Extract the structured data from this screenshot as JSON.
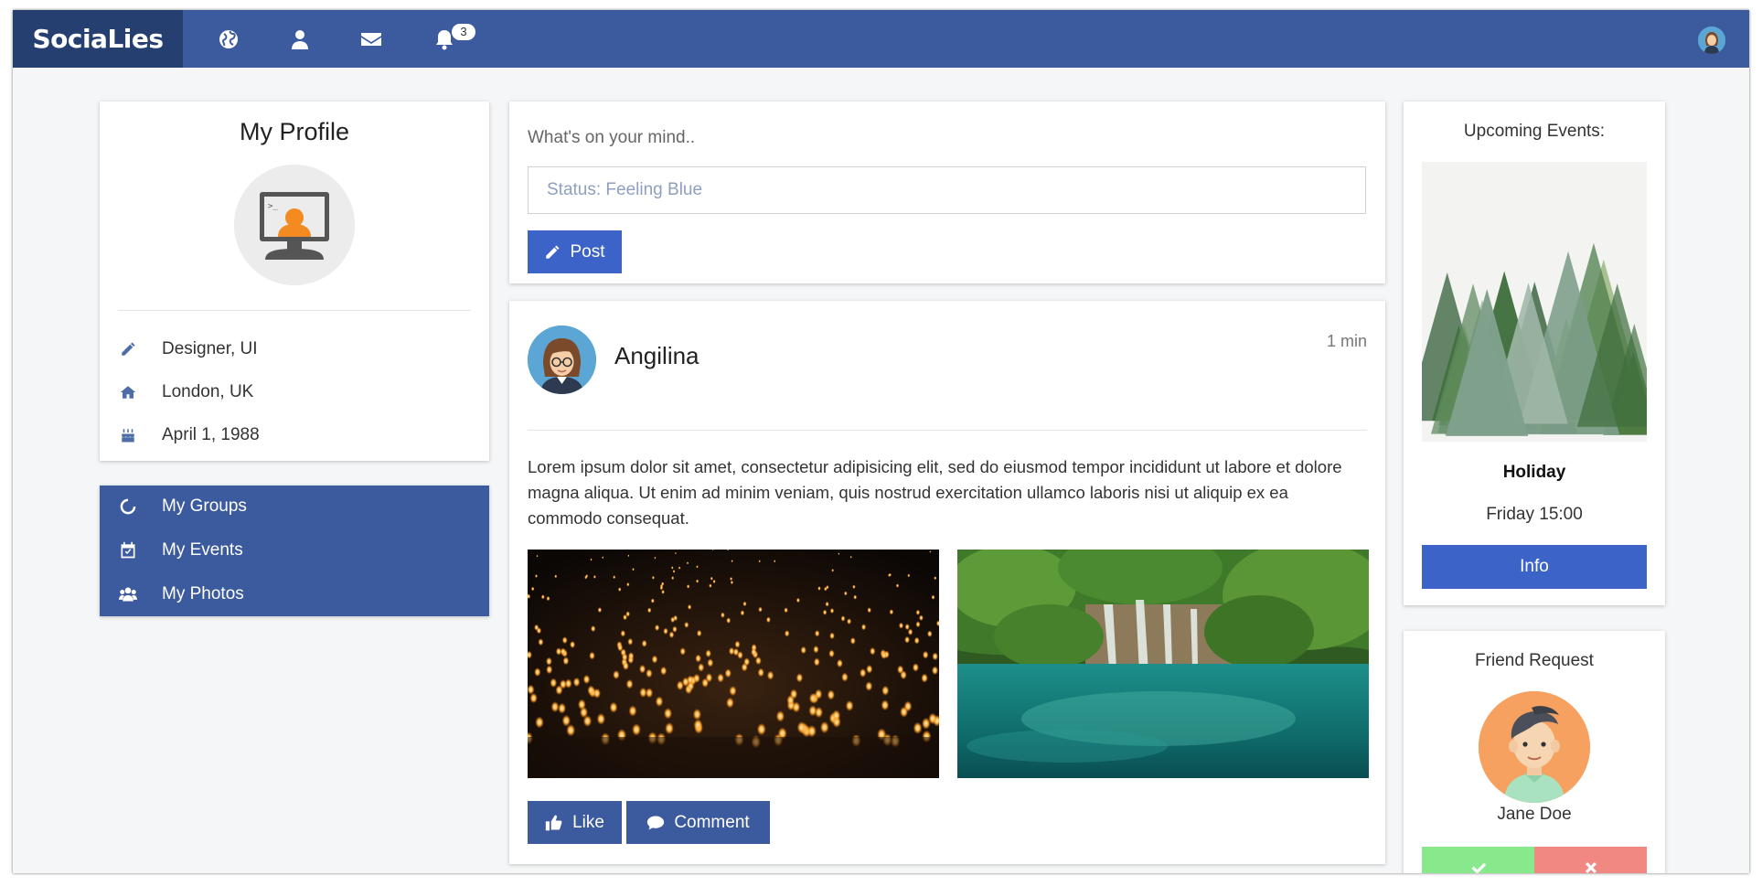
{
  "navbar": {
    "brand": "SociaLies",
    "notification_count": "3",
    "icons": [
      "globe-icon",
      "user-icon",
      "envelope-icon",
      "bell-icon"
    ],
    "color": "#3c5a9e",
    "brand_color": "#253f70"
  },
  "profile": {
    "title": "My Profile",
    "details": [
      {
        "icon": "pencil-icon",
        "text": "Designer, UI"
      },
      {
        "icon": "home-icon",
        "text": "London, UK"
      },
      {
        "icon": "birthday-cake-icon",
        "text": "April 1, 1988"
      }
    ]
  },
  "menu": {
    "items": [
      {
        "icon": "circle-notch-icon",
        "label": "My Groups"
      },
      {
        "icon": "calendar-check-icon",
        "label": "My Events"
      },
      {
        "icon": "users-icon",
        "label": "My Photos"
      }
    ]
  },
  "composer": {
    "prompt": "What's on your mind..",
    "placeholder": "Status: Feeling Blue",
    "post_label": "Post"
  },
  "post": {
    "author": "Angilina",
    "time": "1 min",
    "text": "Lorem ipsum dolor sit amet, consectetur adipisicing elit, sed do eiusmod tempor incididunt ut labore et dolore magna aliqua. Ut enim ad minim veniam, quis nostrud exercitation ullamco laboris nisi ut aliquip ex ea commodo consequat.",
    "images": [
      "sky-lanterns-photo",
      "waterfall-lagoon-photo"
    ],
    "like_label": "Like",
    "comment_label": "Comment"
  },
  "events": {
    "title": "Upcoming Events:",
    "event_name": "Holiday",
    "event_time": "Friday 15:00",
    "info_label": "Info"
  },
  "friend_request": {
    "title": "Friend Request",
    "name": "Jane Doe",
    "accept_color": "#87e88c",
    "decline_color": "#f28882"
  },
  "colors": {
    "accent": "#3c64c8",
    "primary": "#3c5a9e"
  }
}
